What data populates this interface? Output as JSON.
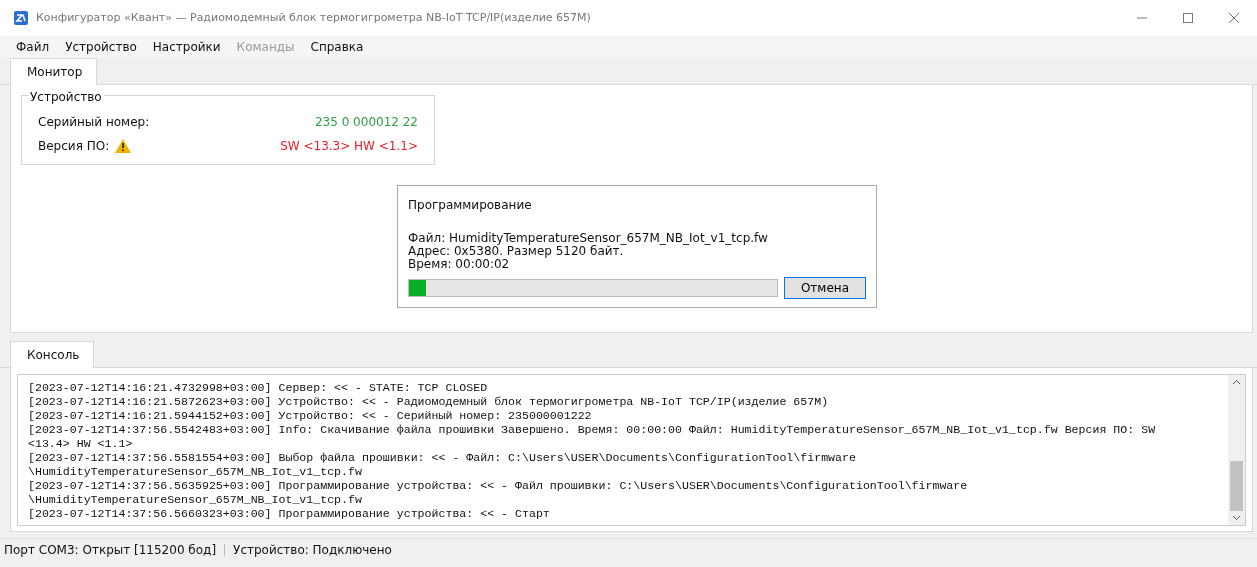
{
  "window": {
    "title": "Конфигуратор «Квант» — Радиомодемный блок термогигрометра NB-IoT TCP/IP(изделие 657M)"
  },
  "menu": [
    {
      "label": "Файл",
      "disabled": false
    },
    {
      "label": "Устройство",
      "disabled": false
    },
    {
      "label": "Настройки",
      "disabled": false
    },
    {
      "label": "Команды",
      "disabled": true
    },
    {
      "label": "Справка",
      "disabled": false
    }
  ],
  "tabs": [
    {
      "label": "Монитор",
      "selected": true
    }
  ],
  "device": {
    "title": "Устройство",
    "fields": [
      {
        "label": "Серийный номер:",
        "value": "235 0 000012 22",
        "warning": false,
        "color": "#2e9e3e"
      },
      {
        "label": "Версия ПО:",
        "value": "SW <13.3> HW <1.1>",
        "warning": true,
        "color": "#e8202a"
      }
    ]
  },
  "programming": {
    "title": "Программирование",
    "lines": [
      "Файл: HumidityTemperatureSensor_657M_NB_Iot_v1_tcp.fw",
      "Адрес: 0x5380. Размер 5120 байт.",
      "Время: 00:00:02"
    ],
    "level": 0.045,
    "cancel": "Отмена"
  },
  "console_tabs": [
    {
      "label": "Консоль",
      "selected": true
    }
  ],
  "console": {
    "lines": [
      "[2023-07-12T14:16:21.4732998+03:00] Сервер: << - STATE: TCP CLOSED",
      "[2023-07-12T14:16:21.5872623+03:00] Устройство: << - Радиомодемный блок термогигрометра NB-IoT TCP/IP(изделие 657M)",
      "[2023-07-12T14:16:21.5944152+03:00] Устройство: << - Серийный номер: 235000001222",
      "[2023-07-12T14:37:56.5542483+03:00] Info: Скачивание файла прошивки Завершено. Время: 00:00:00 Файл: HumidityTemperatureSensor_657M_NB_Iot_v1_tcp.fw Версия ПО: SW",
      "<13.4> HW <1.1>",
      "[2023-07-12T14:37:56.5581554+03:00] Выбор файла прошивки: << - Файл: C:\\Users\\USER\\Documents\\ConfigurationTool\\firmware",
      "\\HumidityTemperatureSensor_657M_NB_Iot_v1_tcp.fw",
      "[2023-07-12T14:37:56.5635925+03:00] Программирование устройства: << - Файл прошивки: C:\\Users\\USER\\Documents\\ConfigurationTool\\firmware",
      "\\HumidityTemperatureSensor_657M_NB_Iot_v1_tcp.fw",
      "[2023-07-12T14:37:56.5660323+03:00] Программирование устройства: << - Старт"
    ]
  },
  "status_bar": [
    "Порт COM3: Открыт [115200 бод]",
    "Устройство: Подключено"
  ]
}
